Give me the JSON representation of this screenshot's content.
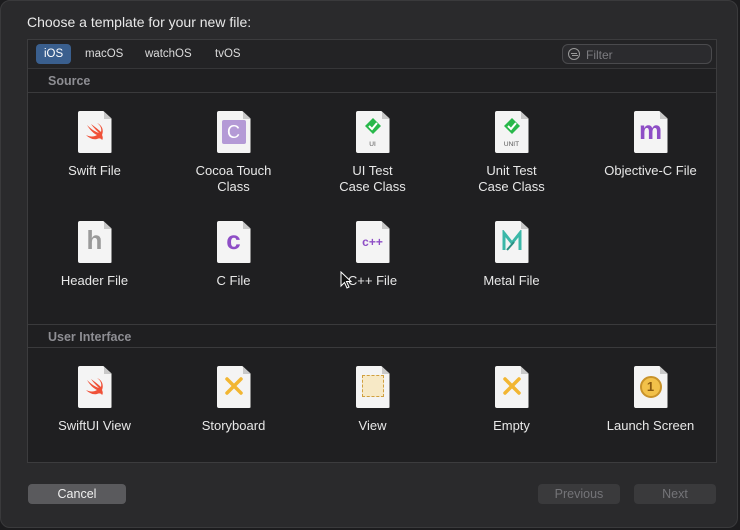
{
  "dialog": {
    "title": "Choose a template for your new file:"
  },
  "tabs": [
    {
      "label": "iOS",
      "active": true
    },
    {
      "label": "macOS",
      "active": false
    },
    {
      "label": "watchOS",
      "active": false
    },
    {
      "label": "tvOS",
      "active": false
    }
  ],
  "filter": {
    "placeholder": "Filter",
    "value": ""
  },
  "sections": {
    "source": {
      "title": "Source",
      "items": [
        {
          "label": "Swift File",
          "icon": "swift-icon"
        },
        {
          "label": "Cocoa Touch\nClass",
          "icon": "cocoa-class-icon",
          "glyph": "C"
        },
        {
          "label": "UI Test\nCase Class",
          "icon": "ui-test-icon",
          "sublabel": "UI"
        },
        {
          "label": "Unit Test\nCase Class",
          "icon": "unit-test-icon",
          "sublabel": "UNIT"
        },
        {
          "label": "Objective-C File",
          "icon": "objc-icon",
          "glyph": "m"
        },
        {
          "label": "Header File",
          "icon": "header-icon",
          "glyph": "h"
        },
        {
          "label": "C File",
          "icon": "c-file-icon",
          "glyph": "c"
        },
        {
          "label": "C++ File",
          "icon": "cpp-file-icon",
          "glyph": "c++"
        },
        {
          "label": "Metal File",
          "icon": "metal-icon"
        }
      ]
    },
    "user_interface": {
      "title": "User Interface",
      "items": [
        {
          "label": "SwiftUI View",
          "icon": "swift-icon"
        },
        {
          "label": "Storyboard",
          "icon": "storyboard-icon"
        },
        {
          "label": "View",
          "icon": "view-icon"
        },
        {
          "label": "Empty",
          "icon": "empty-icon"
        },
        {
          "label": "Launch Screen",
          "icon": "launch-screen-icon",
          "glyph": "1"
        }
      ]
    }
  },
  "buttons": {
    "cancel": "Cancel",
    "previous": "Previous",
    "next": "Next"
  },
  "colors": {
    "swift": "#f05138",
    "purple": "#8e4ec6",
    "green": "#28b84a",
    "xib_yellow": "#f2b632",
    "metal_teal": "#3bb8a8",
    "accent_tab": "#3a5f8e"
  }
}
